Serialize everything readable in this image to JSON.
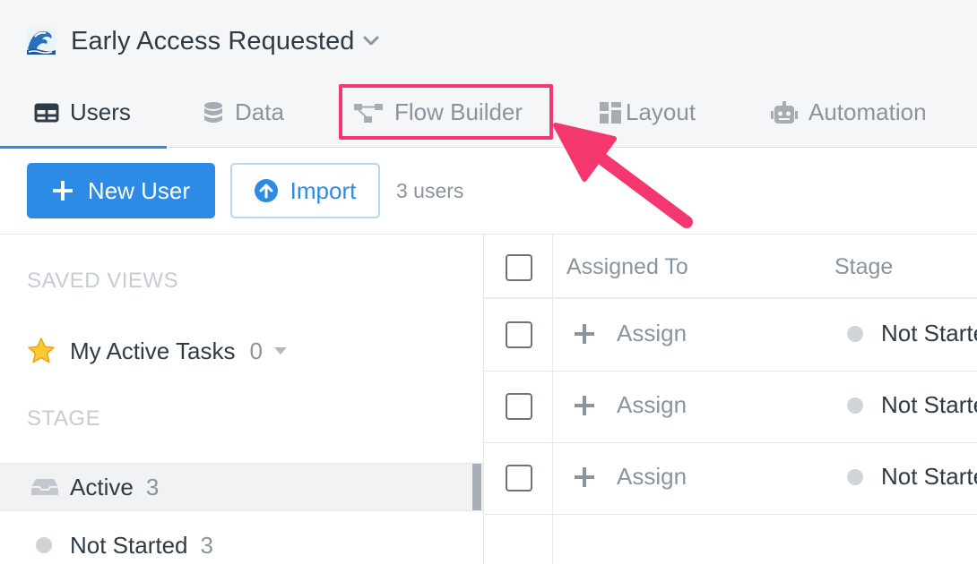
{
  "header": {
    "title": "Early Access Requested",
    "icons": {
      "title": "wave-emoji-icon",
      "chevron": "chevron-down-icon"
    }
  },
  "tabs": [
    {
      "label": "Users",
      "icon": "table-grid-icon",
      "active": true
    },
    {
      "label": "Data",
      "icon": "database-icon",
      "active": false
    },
    {
      "label": "Flow Builder",
      "icon": "flow-diagram-icon",
      "active": false,
      "highlighted": true
    },
    {
      "label": "Layout",
      "icon": "layout-icon",
      "active": false
    },
    {
      "label": "Automation",
      "icon": "robot-icon",
      "active": false
    }
  ],
  "toolbar": {
    "new_user_label": "New User",
    "import_label": "Import",
    "user_count": "3 users"
  },
  "sidebar": {
    "saved_views_heading": "SAVED VIEWS",
    "saved_views": [
      {
        "label": "My Active Tasks",
        "count": "0",
        "icon": "star-icon"
      }
    ],
    "stage_heading": "STAGE",
    "stages": [
      {
        "label": "Active",
        "count": "3",
        "icon": "inbox-tray-icon",
        "selected": true
      },
      {
        "label": "Not Started",
        "count": "3",
        "icon": "status-dot-icon",
        "selected": false
      }
    ]
  },
  "table": {
    "columns": [
      "Assigned To",
      "Stage"
    ],
    "rows": [
      {
        "assigned": "Assign",
        "stage": "Not Started"
      },
      {
        "assigned": "Assign",
        "stage": "Not Started"
      },
      {
        "assigned": "Assign",
        "stage": "Not Started"
      }
    ]
  },
  "colors": {
    "accent": "#2d8ae5",
    "highlight": "#f4386f",
    "header_bg": "#f5f6f8",
    "muted_text": "#8a949e"
  }
}
